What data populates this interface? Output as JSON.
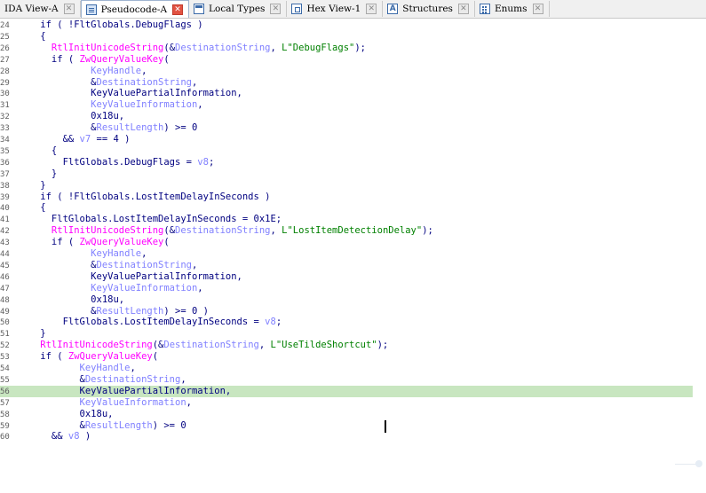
{
  "tabs": [
    {
      "label": "IDA View-A",
      "icon": "none",
      "active": false
    },
    {
      "label": "Pseudocode-A",
      "icon": "pseudocode-icon",
      "active": true
    },
    {
      "label": "Local Types",
      "icon": "local-types-icon",
      "active": false
    },
    {
      "label": "Hex View-1",
      "icon": "hex-view-icon",
      "active": false
    },
    {
      "label": "Structures",
      "icon": "structures-icon",
      "active": false
    },
    {
      "label": "Enums",
      "icon": "enums-icon",
      "active": false
    }
  ],
  "close_glyph": "✕",
  "structures_icon_glyph": "A",
  "colors": {
    "keyword": "#000080",
    "function": "#ff00ff",
    "number": "#008080",
    "string": "#008000",
    "variable": "#8080ff",
    "highlight": "#c8e6c0",
    "active_close": "#e25242"
  },
  "highlighted_line": 36,
  "lines": [
    {
      "n": "24",
      "tokens": [
        [
          "plain",
          "    if ( !FltGlobals.DebugFlags )"
        ]
      ]
    },
    {
      "n": "25",
      "tokens": [
        [
          "plain",
          "    {"
        ]
      ]
    },
    {
      "n": "26",
      "tokens": [
        [
          "fn",
          "      RtlInitUnicodeString"
        ],
        [
          "plain",
          "(&"
        ],
        [
          "var",
          "DestinationString"
        ],
        [
          "plain",
          ", "
        ],
        [
          "str",
          "L\"DebugFlags\""
        ],
        [
          "plain",
          ");"
        ]
      ]
    },
    {
      "n": "27",
      "tokens": [
        [
          "plain",
          "      if ( "
        ],
        [
          "fn",
          "ZwQueryValueKey"
        ],
        [
          "plain",
          "("
        ]
      ]
    },
    {
      "n": "28",
      "tokens": [
        [
          "var",
          "             KeyHandle"
        ],
        [
          "plain",
          ","
        ]
      ]
    },
    {
      "n": "29",
      "tokens": [
        [
          "plain",
          "             &"
        ],
        [
          "var",
          "DestinationString"
        ],
        [
          "plain",
          ","
        ]
      ]
    },
    {
      "n": "30",
      "tokens": [
        [
          "plain",
          "             KeyValuePartialInformation,"
        ]
      ]
    },
    {
      "n": "31",
      "tokens": [
        [
          "var",
          "             KeyValueInformation"
        ],
        [
          "plain",
          ","
        ]
      ]
    },
    {
      "n": "32",
      "tokens": [
        [
          "plain",
          "             0x18u,"
        ]
      ]
    },
    {
      "n": "33",
      "tokens": [
        [
          "plain",
          "             &"
        ],
        [
          "var",
          "ResultLength"
        ],
        [
          "plain",
          ") >= 0"
        ]
      ]
    },
    {
      "n": "34",
      "tokens": [
        [
          "plain",
          "        && "
        ],
        [
          "var",
          "v7"
        ],
        [
          "plain",
          " == 4 )"
        ]
      ]
    },
    {
      "n": "35",
      "tokens": [
        [
          "plain",
          "      {"
        ]
      ]
    },
    {
      "n": "36",
      "tokens": [
        [
          "plain",
          "        FltGlobals.DebugFlags = "
        ],
        [
          "var",
          "v8"
        ],
        [
          "plain",
          ";"
        ]
      ]
    },
    {
      "n": "37",
      "tokens": [
        [
          "plain",
          "      }"
        ]
      ]
    },
    {
      "n": "38",
      "tokens": [
        [
          "plain",
          "    }"
        ]
      ]
    },
    {
      "n": "39",
      "tokens": [
        [
          "plain",
          "    if ( !FltGlobals.LostItemDelayInSeconds )"
        ]
      ]
    },
    {
      "n": "40",
      "tokens": [
        [
          "plain",
          "    {"
        ]
      ]
    },
    {
      "n": "41",
      "tokens": [
        [
          "plain",
          "      FltGlobals.LostItemDelayInSeconds = 0x1E;"
        ]
      ]
    },
    {
      "n": "42",
      "tokens": [
        [
          "fn",
          "      RtlInitUnicodeString"
        ],
        [
          "plain",
          "(&"
        ],
        [
          "var",
          "DestinationString"
        ],
        [
          "plain",
          ", "
        ],
        [
          "str",
          "L\"LostItemDetectionDelay\""
        ],
        [
          "plain",
          ");"
        ]
      ]
    },
    {
      "n": "43",
      "tokens": [
        [
          "plain",
          "      if ( "
        ],
        [
          "fn",
          "ZwQueryValueKey"
        ],
        [
          "plain",
          "("
        ]
      ]
    },
    {
      "n": "44",
      "tokens": [
        [
          "var",
          "             KeyHandle"
        ],
        [
          "plain",
          ","
        ]
      ]
    },
    {
      "n": "45",
      "tokens": [
        [
          "plain",
          "             &"
        ],
        [
          "var",
          "DestinationString"
        ],
        [
          "plain",
          ","
        ]
      ]
    },
    {
      "n": "46",
      "tokens": [
        [
          "plain",
          "             KeyValuePartialInformation,"
        ]
      ]
    },
    {
      "n": "47",
      "tokens": [
        [
          "var",
          "             KeyValueInformation"
        ],
        [
          "plain",
          ","
        ]
      ]
    },
    {
      "n": "48",
      "tokens": [
        [
          "plain",
          "             0x18u,"
        ]
      ]
    },
    {
      "n": "49",
      "tokens": [
        [
          "plain",
          "             &"
        ],
        [
          "var",
          "ResultLength"
        ],
        [
          "plain",
          ") >= 0 )"
        ]
      ]
    },
    {
      "n": "50",
      "tokens": [
        [
          "plain",
          "        FltGlobals.LostItemDelayInSeconds = "
        ],
        [
          "var",
          "v8"
        ],
        [
          "plain",
          ";"
        ]
      ]
    },
    {
      "n": "51",
      "tokens": [
        [
          "plain",
          "    }"
        ]
      ]
    },
    {
      "n": "52",
      "tokens": [
        [
          "fn",
          "    RtlInitUnicodeString"
        ],
        [
          "plain",
          "(&"
        ],
        [
          "var",
          "DestinationString"
        ],
        [
          "plain",
          ", "
        ],
        [
          "str",
          "L\"UseTildeShortcut\""
        ],
        [
          "plain",
          ");"
        ]
      ]
    },
    {
      "n": "53",
      "tokens": [
        [
          "plain",
          "    if ( "
        ],
        [
          "fn",
          "ZwQueryValueKey"
        ],
        [
          "plain",
          "("
        ]
      ]
    },
    {
      "n": "54",
      "tokens": [
        [
          "var",
          "           KeyHandle"
        ],
        [
          "plain",
          ","
        ]
      ]
    },
    {
      "n": "55",
      "tokens": [
        [
          "plain",
          "           &"
        ],
        [
          "var",
          "DestinationString"
        ],
        [
          "plain",
          ","
        ]
      ]
    },
    {
      "n": "56",
      "tokens": [
        [
          "plain",
          "           KeyValuePartialInformation,"
        ]
      ]
    },
    {
      "n": "57",
      "tokens": [
        [
          "var",
          "           KeyValueInformation"
        ],
        [
          "plain",
          ","
        ]
      ]
    },
    {
      "n": "58",
      "tokens": [
        [
          "plain",
          "           0x18u,"
        ]
      ]
    },
    {
      "n": "59",
      "tokens": [
        [
          "plain",
          "           &"
        ],
        [
          "var",
          "ResultLength"
        ],
        [
          "plain",
          ") >= 0"
        ]
      ]
    },
    {
      "n": "60",
      "tokens": [
        [
          "plain",
          "      && "
        ],
        [
          "var",
          "v8"
        ],
        [
          "plain",
          " )"
        ]
      ]
    }
  ]
}
